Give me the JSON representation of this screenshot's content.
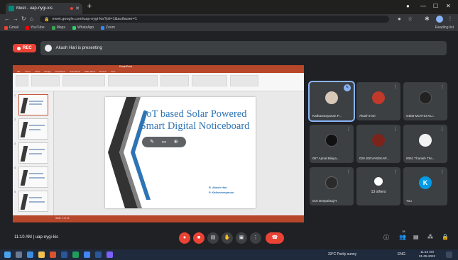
{
  "browser": {
    "tab_title": "Meet - uap-nygi-kis",
    "url": "meet.google.com/uap-nygi-kis?pli=1&authuser=1",
    "bookmarks": [
      "Gmail",
      "YouTube",
      "Maps",
      "WhatsApp",
      "Zoom"
    ],
    "reading_list": "Reading list"
  },
  "meet": {
    "rec_label": "REC",
    "presenting_text": "Akash Hari is presenting",
    "time": "11:10 AM",
    "separator": "|",
    "meeting_code": "uap-nygi-kis",
    "people_count": "18"
  },
  "presentation": {
    "window_title": "PowerPoint",
    "ribbon_tabs": [
      "File",
      "Home",
      "Insert",
      "Design",
      "Transitions",
      "Animations",
      "Slide Show",
      "Review",
      "View"
    ],
    "slide_title": "IoT based Solar Powered Smart Digital Noticeboard",
    "authors": [
      "R. Akash Hari",
      "P. Kathavarayanan"
    ],
    "status_text": "Slide 1 of 12",
    "thumbnail_numbers": [
      "1",
      "2",
      "3",
      "4",
      "5"
    ]
  },
  "participants": [
    {
      "name": "Kathavarayanan P...",
      "color": "#d8c8b8",
      "initial": "",
      "speaking": true
    },
    {
      "name": "Akash Hari",
      "color": "#c0392b",
      "initial": ""
    },
    {
      "name": "G505 MUTHU KU...",
      "color": "#222222",
      "initial": ""
    },
    {
      "name": "007 Ajmal Bilaya...",
      "color": "#111111",
      "initial": ""
    },
    {
      "name": "029 JEEVASEKAR...",
      "color": "#7b241c",
      "initial": ""
    },
    {
      "name": "0061 Thanish The...",
      "color": "#f2f2f2",
      "initial": ""
    },
    {
      "name": "010 Deepakraj R",
      "color": "#2b2b2b",
      "initial": ""
    },
    {
      "name": "13 others",
      "color": "#ffffff",
      "initial": ""
    },
    {
      "name": "You",
      "color": "#039be5",
      "initial": "K"
    }
  ],
  "taskbar": {
    "weather": "33°C Partly sunny",
    "clock_time": "11:10 AM",
    "clock_date": "01-05-2022",
    "lang": "ENG"
  },
  "colors": {
    "meet_bg": "#202124",
    "tile_bg": "#3c4043",
    "accent": "#8ab4f8",
    "danger": "#ea4335",
    "ppt_accent": "#b7472a",
    "slide_text": "#2e74b5"
  }
}
